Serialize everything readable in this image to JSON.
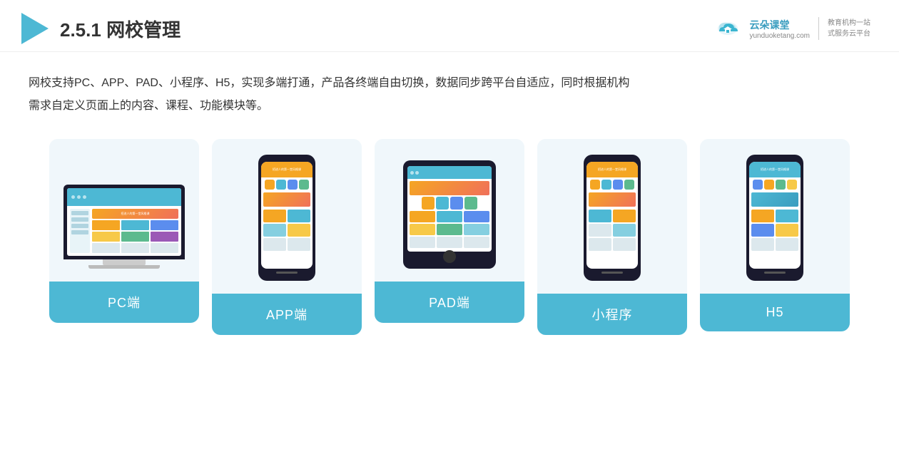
{
  "header": {
    "section_number": "2.5.1",
    "title_plain": "网校管理",
    "logo_name": "云朵课堂",
    "logo_domain": "yunduoketang.com",
    "logo_slogan_line1": "教育机构一站",
    "logo_slogan_line2": "式服务云平台"
  },
  "description": {
    "line1": "网校支持PC、APP、PAD、小程序、H5，实现多端打通，产品各终端自由切换，数据同步跨平台自适应，同时根据机构",
    "line2": "需求自定义页面上的内容、课程、功能模块等。"
  },
  "cards": [
    {
      "id": "pc",
      "label": "PC端"
    },
    {
      "id": "app",
      "label": "APP端"
    },
    {
      "id": "pad",
      "label": "PAD端"
    },
    {
      "id": "miniprogram",
      "label": "小程序"
    },
    {
      "id": "h5",
      "label": "H5"
    }
  ]
}
